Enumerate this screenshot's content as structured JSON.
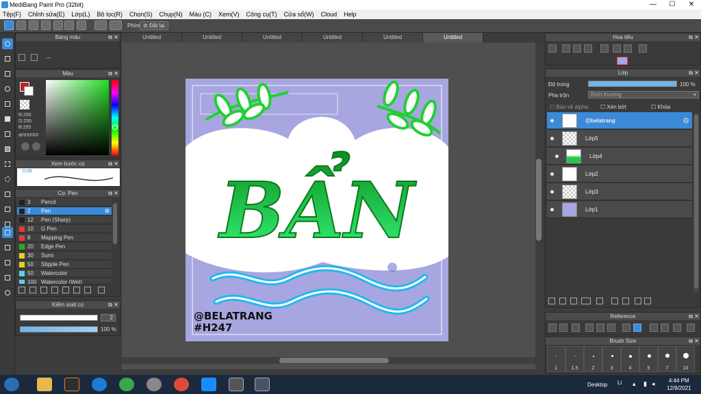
{
  "window": {
    "title": "MediBang Paint Pro (32bit)",
    "min": "—",
    "max": "☐",
    "close": "✕"
  },
  "menu": [
    "Tệp(F)",
    "Chỉnh sửa(E)",
    "Lớp(L)",
    "Bộ lọc(R)",
    "Chọn(S)",
    "Chụp(N)",
    "Màu (C)",
    "Xem(V)",
    "Công cụ(T)",
    "Cửa sổ(W)",
    "Cloud",
    "Help"
  ],
  "toolbar": {
    "key_label": "Phím",
    "reset_label": "Đặt lại"
  },
  "tabs": [
    "Untitled",
    "Untitled",
    "Untitled",
    "Untitled",
    "Untitled",
    "Untitled"
  ],
  "panels": {
    "color_palette": "Bảng màu",
    "palette_dash": "---",
    "color": "Màu",
    "rgb": {
      "r": "R:255",
      "g": "G:255",
      "b": "B:255",
      "hex": "#FFFFFF"
    },
    "brush_preview": "Xem trước cọ",
    "brush_preview_value": "0.08",
    "brush": "Cọ: Pen",
    "brush_control": "Kiểm soát cọ",
    "brush_size_value": "2",
    "brush_opacity_value": "100 %",
    "navigator": "Hoa tiêu",
    "layer": "Lớp",
    "opacity_label": "Độ trong",
    "opacity_value": "100 %",
    "blend_label": "Pha trộn",
    "blend_value": "Bình thường",
    "protect_alpha": "Bảo vệ alpha",
    "clipping": "Xén bớt",
    "lock": "Khóa",
    "reference": "Reference",
    "brush_size": "Brush Size"
  },
  "brushes": [
    {
      "size": "3",
      "name": "Pencil",
      "color": "#222222"
    },
    {
      "size": "2",
      "name": "Pen",
      "color": "#222222"
    },
    {
      "size": "12",
      "name": "Pen (Sharp)",
      "color": "#222222"
    },
    {
      "size": "10",
      "name": "G Pen",
      "color": "#e03a3a"
    },
    {
      "size": "8",
      "name": "Mapping Pen",
      "color": "#e03a3a"
    },
    {
      "size": "20",
      "name": "Edge Pen",
      "color": "#2aa82a"
    },
    {
      "size": "30",
      "name": "Sumi",
      "color": "#e6d11e"
    },
    {
      "size": "50",
      "name": "Stipple Pen",
      "color": "#e6d11e"
    },
    {
      "size": "50",
      "name": "Watercolor",
      "color": "#5ad0e8"
    },
    {
      "size": "100",
      "name": "Watercolor (Wet)",
      "color": "#5ad0e8"
    }
  ],
  "layers": [
    "@belatrang",
    "Lớp5",
    "Lớp4",
    "Lớp2",
    "Lớp3",
    "Lớp1"
  ],
  "brush_sizes": [
    "1",
    "1.5",
    "2",
    "3",
    "4",
    "5",
    "7",
    "10"
  ],
  "artwork": {
    "title": "BẨN",
    "tag1": "@BELATRANG",
    "tag2": "#H247"
  },
  "taskbar": {
    "desktop": "Desktop",
    "time": "4:44 PM",
    "date": "12/9/2021",
    "lang": "Li"
  },
  "colors": {
    "accent": "#3a8ad8",
    "art_bg": "#a7a6e0",
    "green": "#1fd12f",
    "cyan": "#2ec8f0"
  }
}
